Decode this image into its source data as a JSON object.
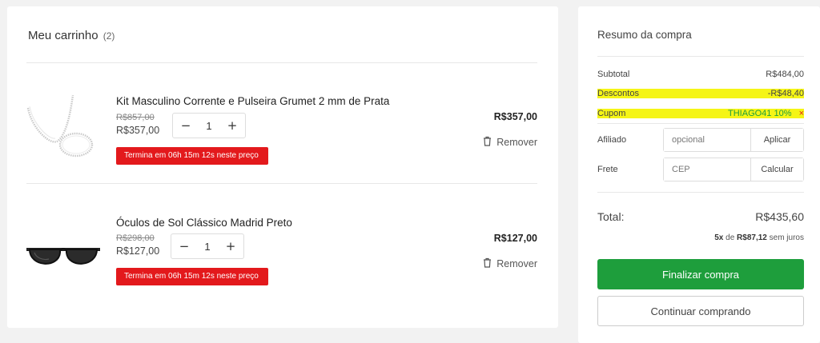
{
  "cart": {
    "title": "Meu carrinho",
    "count": "(2)",
    "items": [
      {
        "name": "Kit Masculino Corrente e Pulseira Grumet 2 mm de Prata",
        "old_price": "R$857,00",
        "price": "R$357,00",
        "quantity": "1",
        "timer": "Termina em 06h 15m 12s neste preço",
        "line_total": "R$357,00",
        "remove_label": "Remover",
        "image_icon": "silver-chain-icon"
      },
      {
        "name": "Óculos de Sol Clássico Madrid Preto",
        "old_price": "R$298,00",
        "price": "R$127,00",
        "quantity": "1",
        "timer": "Termina em 06h 15m 12s neste preço",
        "line_total": "R$127,00",
        "remove_label": "Remover",
        "image_icon": "sunglasses-icon"
      }
    ],
    "qty_minus": "−",
    "qty_plus": "+"
  },
  "summary": {
    "title": "Resumo da compra",
    "subtotal_label": "Subtotal",
    "subtotal_value": "R$484,00",
    "discount_label": "Descontos",
    "discount_value": "-R$48,40",
    "coupon_label": "Cupom",
    "coupon_value": "THIAGO41 10%",
    "coupon_remove": "×",
    "affiliate_label": "Afiliado",
    "affiliate_placeholder": "opcional",
    "affiliate_button": "Aplicar",
    "shipping_label": "Frete",
    "shipping_placeholder": "CEP",
    "shipping_button": "Calcular",
    "total_label": "Total:",
    "total_value": "R$435,60",
    "installments_count": "5x",
    "installments_of": "de",
    "installments_value": "R$87,12",
    "installments_suffix": "sem juros",
    "checkout_button": "Finalizar compra",
    "continue_button": "Continuar comprando"
  },
  "colors": {
    "accent_green": "#1e9e3c",
    "timer_red": "#e3191c",
    "highlight_yellow": "#f5f516"
  }
}
